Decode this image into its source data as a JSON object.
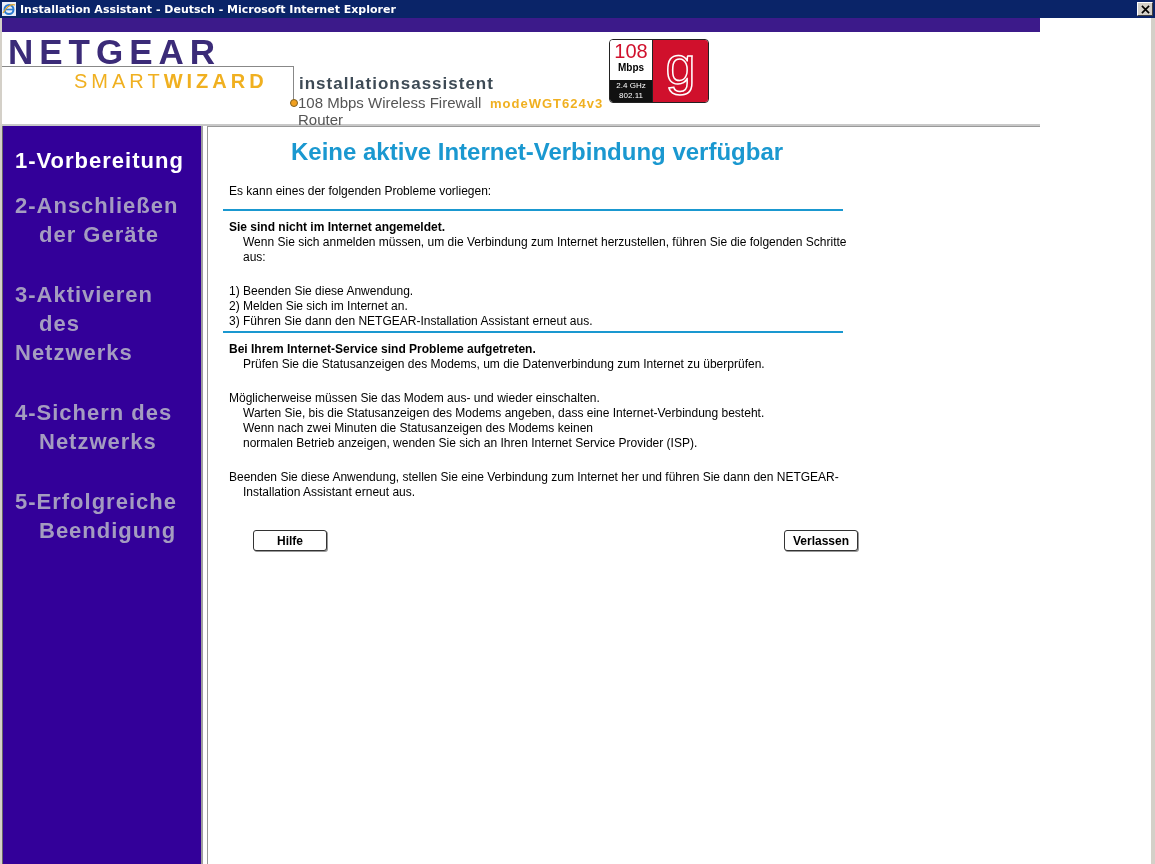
{
  "window": {
    "title": "Installation Assistant - Deutsch - Microsoft Internet Explorer"
  },
  "header": {
    "logo": "NETGEAR",
    "logo_sub": "SMART**WIZARD**",
    "app_title": "installationsassistent",
    "product": "108 Mbps Wireless Firewall Router",
    "model": "modeWGT624v3",
    "badge": {
      "speed": "108",
      "unit": "Mbps",
      "band": "2.4 GHz",
      "standard": "802.11",
      "letter": "g"
    }
  },
  "sidebar": {
    "items": [
      {
        "selected": true,
        "lines": [
          {
            "text": "1-Vorbereitung",
            "indented": false
          }
        ]
      },
      {
        "selected": false,
        "lines": [
          {
            "text": "2-Anschließen",
            "indented": false
          },
          {
            "text": "der Geräte",
            "indented": true
          }
        ]
      },
      {
        "selected": false,
        "lines": [
          {
            "text": "3-Aktivieren",
            "indented": false
          },
          {
            "text": "des",
            "indented": true
          },
          {
            "text": "Netzwerks",
            "indented": false
          }
        ]
      },
      {
        "selected": false,
        "lines": [
          {
            "text": "4-Sichern des",
            "indented": false
          },
          {
            "text": "Netzwerks",
            "indented": true
          }
        ]
      },
      {
        "selected": false,
        "lines": [
          {
            "text": "5-Erfolgreiche",
            "indented": false
          },
          {
            "text": "Beendigung",
            "indented": true
          }
        ]
      }
    ]
  },
  "content": {
    "heading": "Keine aktive Internet-Verbindung verfügbar",
    "intro": "Es kann eines der folgenden Probleme vorliegen:",
    "sections": [
      {
        "title": "Sie sind nicht im Internet angemeldet.",
        "paragraphs": [
          [
            {
              "text": "Wenn Sie sich anmelden müssen, um die Verbindung zum Internet herzustellen, führen Sie die folgenden Schritte aus:",
              "indented": true
            }
          ],
          [
            {
              "text": "1) Beenden Sie diese Anwendung.",
              "indented": false
            },
            {
              "text": "2) Melden Sie sich im Internet an.",
              "indented": false
            },
            {
              "text": "3) Führen Sie dann den NETGEAR-Installation Assistant erneut aus.",
              "indented": false
            }
          ]
        ]
      },
      {
        "title": "Bei Ihrem Internet-Service sind Probleme aufgetreten.",
        "paragraphs": [
          [
            {
              "text": "Prüfen Sie die Statusanzeigen des Modems, um die Datenverbindung zum Internet zu überprüfen.",
              "indented": true
            }
          ],
          [
            {
              "text": "Möglicherweise müssen Sie das Modem aus- und wieder einschalten.",
              "indented": false
            },
            {
              "text": "Warten Sie, bis die Statusanzeigen des Modems angeben, dass eine Internet-Verbindung besteht.",
              "indented": true
            },
            {
              "text": "Wenn nach zwei Minuten die Statusanzeigen des Modems keinen",
              "indented": true
            },
            {
              "text": "normalen Betrieb anzeigen, wenden Sie sich an Ihren Internet Service Provider (ISP).",
              "indented": true
            }
          ],
          [
            {
              "text": "Beenden Sie diese Anwendung, stellen Sie eine Verbindung zum Internet her und führen Sie dann den NETGEAR-Installation Assistant erneut aus.",
              "indented": false,
              "hanging": true
            }
          ]
        ]
      }
    ]
  },
  "buttons": [
    "Hilfe",
    "Verlassen"
  ]
}
